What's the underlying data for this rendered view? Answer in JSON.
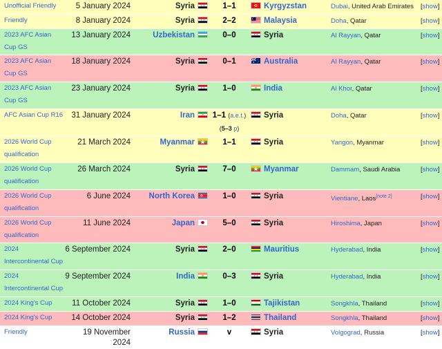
{
  "colors": {
    "draw": "#ffffbb",
    "win": "#bbf3bb",
    "loss": "#ffbbbb",
    "link": "#3366cc",
    "text": "#202122"
  },
  "show_label": "show",
  "aet_label": "a.e.t.",
  "pens_suffix": "p",
  "matches": [
    {
      "result": "draw",
      "competition": "Unofficial Friendly",
      "date": "5 January 2024",
      "home": {
        "name": "Syria",
        "link": false,
        "flag": "syria"
      },
      "score": "1–1",
      "away": {
        "name": "Kyrgyzstan",
        "link": true,
        "flag": "kyrgyzstan"
      },
      "city": "Dubai",
      "country": "United Arab Emirates",
      "height": 18
    },
    {
      "result": "draw",
      "competition": "Friendly",
      "date": "8 January 2024",
      "home": {
        "name": "Syria",
        "link": false,
        "flag": "syria"
      },
      "score": "2–2",
      "away": {
        "name": "Malaysia",
        "link": true,
        "flag": "malaysia"
      },
      "city": "Doha",
      "country": "Qatar",
      "height": 18
    },
    {
      "result": "win",
      "competition": "2023 AFC Asian Cup GS",
      "date": "13 January 2024",
      "home": {
        "name": "Uzbekistan",
        "link": true,
        "flag": "uzbekistan"
      },
      "score": "0–0",
      "away": {
        "name": "Syria",
        "link": false,
        "flag": "syria"
      },
      "city": "Al Rayyan",
      "country": "Qatar",
      "height": 35
    },
    {
      "result": "loss",
      "competition": "2023 AFC Asian Cup GS",
      "date": "18 January 2024",
      "home": {
        "name": "Syria",
        "link": false,
        "flag": "syria"
      },
      "score": "0–1",
      "away": {
        "name": "Australia",
        "link": true,
        "flag": "australia"
      },
      "city": "Al Rayyan",
      "country": "Qatar",
      "height": 36
    },
    {
      "result": "win",
      "competition": "2023 AFC Asian Cup GS",
      "date": "23 January 2024",
      "home": {
        "name": "Syria",
        "link": false,
        "flag": "syria"
      },
      "score": "1–0",
      "away": {
        "name": "India",
        "link": true,
        "flag": "india"
      },
      "city": "Al Khor",
      "country": "Qatar",
      "height": 36
    },
    {
      "result": "draw",
      "competition": "AFC Asian Cup R16",
      "date": "31 January 2024",
      "home": {
        "name": "Iran",
        "link": true,
        "flag": "iran"
      },
      "score": "1–1",
      "aet": true,
      "pens": "5–3",
      "away": {
        "name": "Syria",
        "link": false,
        "flag": "syria"
      },
      "city": "Doha",
      "country": "Qatar",
      "height": 36
    },
    {
      "result": "draw",
      "competition": "2026 World Cup qualification",
      "date": "21 March 2024",
      "home": {
        "name": "Myanmar",
        "link": true,
        "flag": "myanmar"
      },
      "score": "1–1",
      "away": {
        "name": "Syria",
        "link": false,
        "flag": "syria"
      },
      "city": "Yangon",
      "country": "Myanmar",
      "height": 36
    },
    {
      "result": "win",
      "competition": "2026 World Cup qualification",
      "date": "26 March 2024",
      "home": {
        "name": "Syria",
        "link": false,
        "flag": "syria"
      },
      "score": "7–0",
      "away": {
        "name": "Myanmar",
        "link": true,
        "flag": "myanmar"
      },
      "city": "Dammam",
      "country": "Saudi Arabia",
      "height": 36
    },
    {
      "result": "loss",
      "competition": "2026 World Cup qualification",
      "date": "6 June 2024",
      "home": {
        "name": "North Korea",
        "link": true,
        "flag": "northkorea"
      },
      "score": "1–0",
      "away": {
        "name": "Syria",
        "link": false,
        "flag": "syria"
      },
      "city": "Vientiane",
      "country": "Laos",
      "note": "[note 2]",
      "height": 36
    },
    {
      "result": "loss",
      "competition": "2026 World Cup qualification",
      "date": "11 June 2024",
      "home": {
        "name": "Japan",
        "link": true,
        "flag": "japan"
      },
      "score": "5–0",
      "away": {
        "name": "Syria",
        "link": false,
        "flag": "syria"
      },
      "city": "Hiroshima",
      "country": "Japan",
      "height": 35
    },
    {
      "result": "win",
      "competition": "2024 Intercontinental Cup",
      "date": "6 September 2024",
      "home": {
        "name": "Syria",
        "link": false,
        "flag": "syria"
      },
      "score": "2–0",
      "away": {
        "name": "Mauritius",
        "link": true,
        "flag": "mauritius"
      },
      "city": "Hyderabad",
      "country": "India",
      "height": 36
    },
    {
      "result": "win",
      "competition": "2024 Intercontinental Cup",
      "date": "9 September 2024",
      "home": {
        "name": "India",
        "link": true,
        "flag": "india"
      },
      "score": "0–3",
      "away": {
        "name": "Syria",
        "link": false,
        "flag": "syria"
      },
      "city": "Hyderabad",
      "country": "India",
      "height": 36
    },
    {
      "result": "win",
      "competition": "2024 King's Cup",
      "date": "11 October 2024",
      "home": {
        "name": "Syria",
        "link": false,
        "flag": "syria"
      },
      "score": "1–0",
      "away": {
        "name": "Tajikistan",
        "link": true,
        "flag": "tajikistan"
      },
      "city": "Songkhla",
      "country": "Thailand",
      "height": 18
    },
    {
      "result": "loss",
      "competition": "2024 King's Cup",
      "date": "14 October 2024",
      "home": {
        "name": "Syria",
        "link": false,
        "flag": "syria"
      },
      "score": "1–2",
      "away": {
        "name": "Thailand",
        "link": true,
        "flag": "thailand"
      },
      "city": "Songkhla",
      "country": "Thailand",
      "height": 18
    },
    {
      "result": "none",
      "competition": "Friendly",
      "date": "19 November 2024",
      "home": {
        "name": "Russia",
        "link": true,
        "flag": "russia"
      },
      "score": "v",
      "away": {
        "name": "Syria",
        "link": false,
        "flag": "syria"
      },
      "city": "Volgograd",
      "country": "Russia",
      "height": 18
    }
  ]
}
